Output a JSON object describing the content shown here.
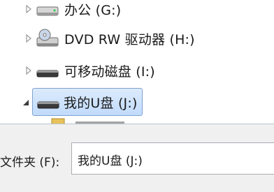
{
  "tree": {
    "items": [
      {
        "label": "办公 (G:)",
        "icon": "drive-icon",
        "expander": "collapsed"
      },
      {
        "label": "DVD RW 驱动器 (H:)",
        "icon": "dvd-drive-icon",
        "expander": "collapsed"
      },
      {
        "label": "可移动磁盘 (I:)",
        "icon": "removable-drive-icon",
        "expander": "collapsed"
      },
      {
        "label": "我的U盘 (J:)",
        "icon": "usb-drive-icon",
        "expander": "expanded",
        "selected": true
      }
    ]
  },
  "footer": {
    "folder_label": "文件夹 (F):",
    "folder_value": "我的U盘 (J:)"
  }
}
